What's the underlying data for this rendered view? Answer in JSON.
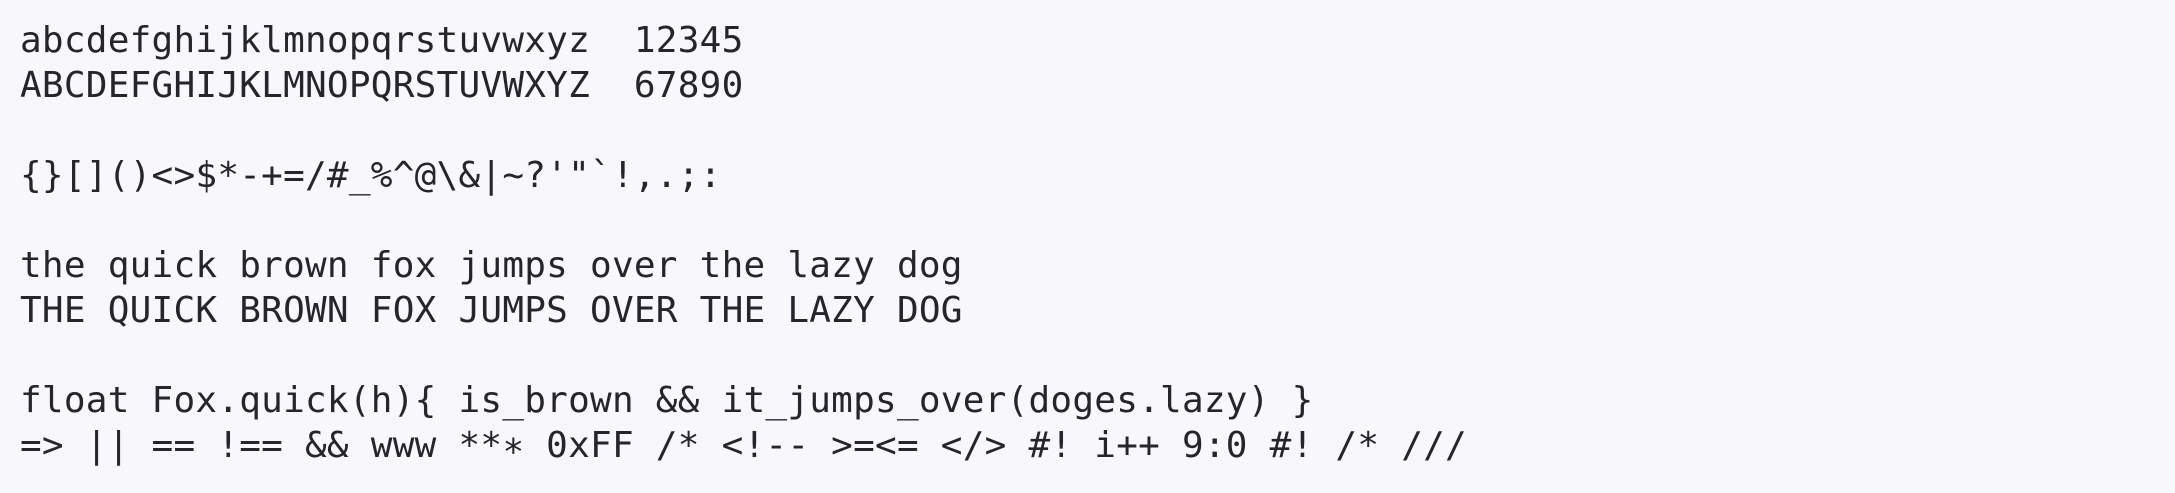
{
  "specimen": {
    "lowercase_line": "abcdefghijklmnopqrstuvwxyz  12345",
    "uppercase_line": "ABCDEFGHIJKLMNOPQRSTUVWXYZ  67890",
    "symbols_line": "{}[]()<>$*-+=/#_%^@\\&|~?'\"`!,.;:",
    "pangram_lower": "the quick brown fox jumps over the lazy dog",
    "pangram_upper": "THE QUICK BROWN FOX JUMPS OVER THE LAZY DOG",
    "code_line": "float Fox.quick(h){ is_brown && it_jumps_over(doges.lazy) }",
    "ligature_line": "=> || == !== && www **∗ 0xFF /* <!-- >=<= </> #! i++ 9:0 #! /* ///"
  }
}
